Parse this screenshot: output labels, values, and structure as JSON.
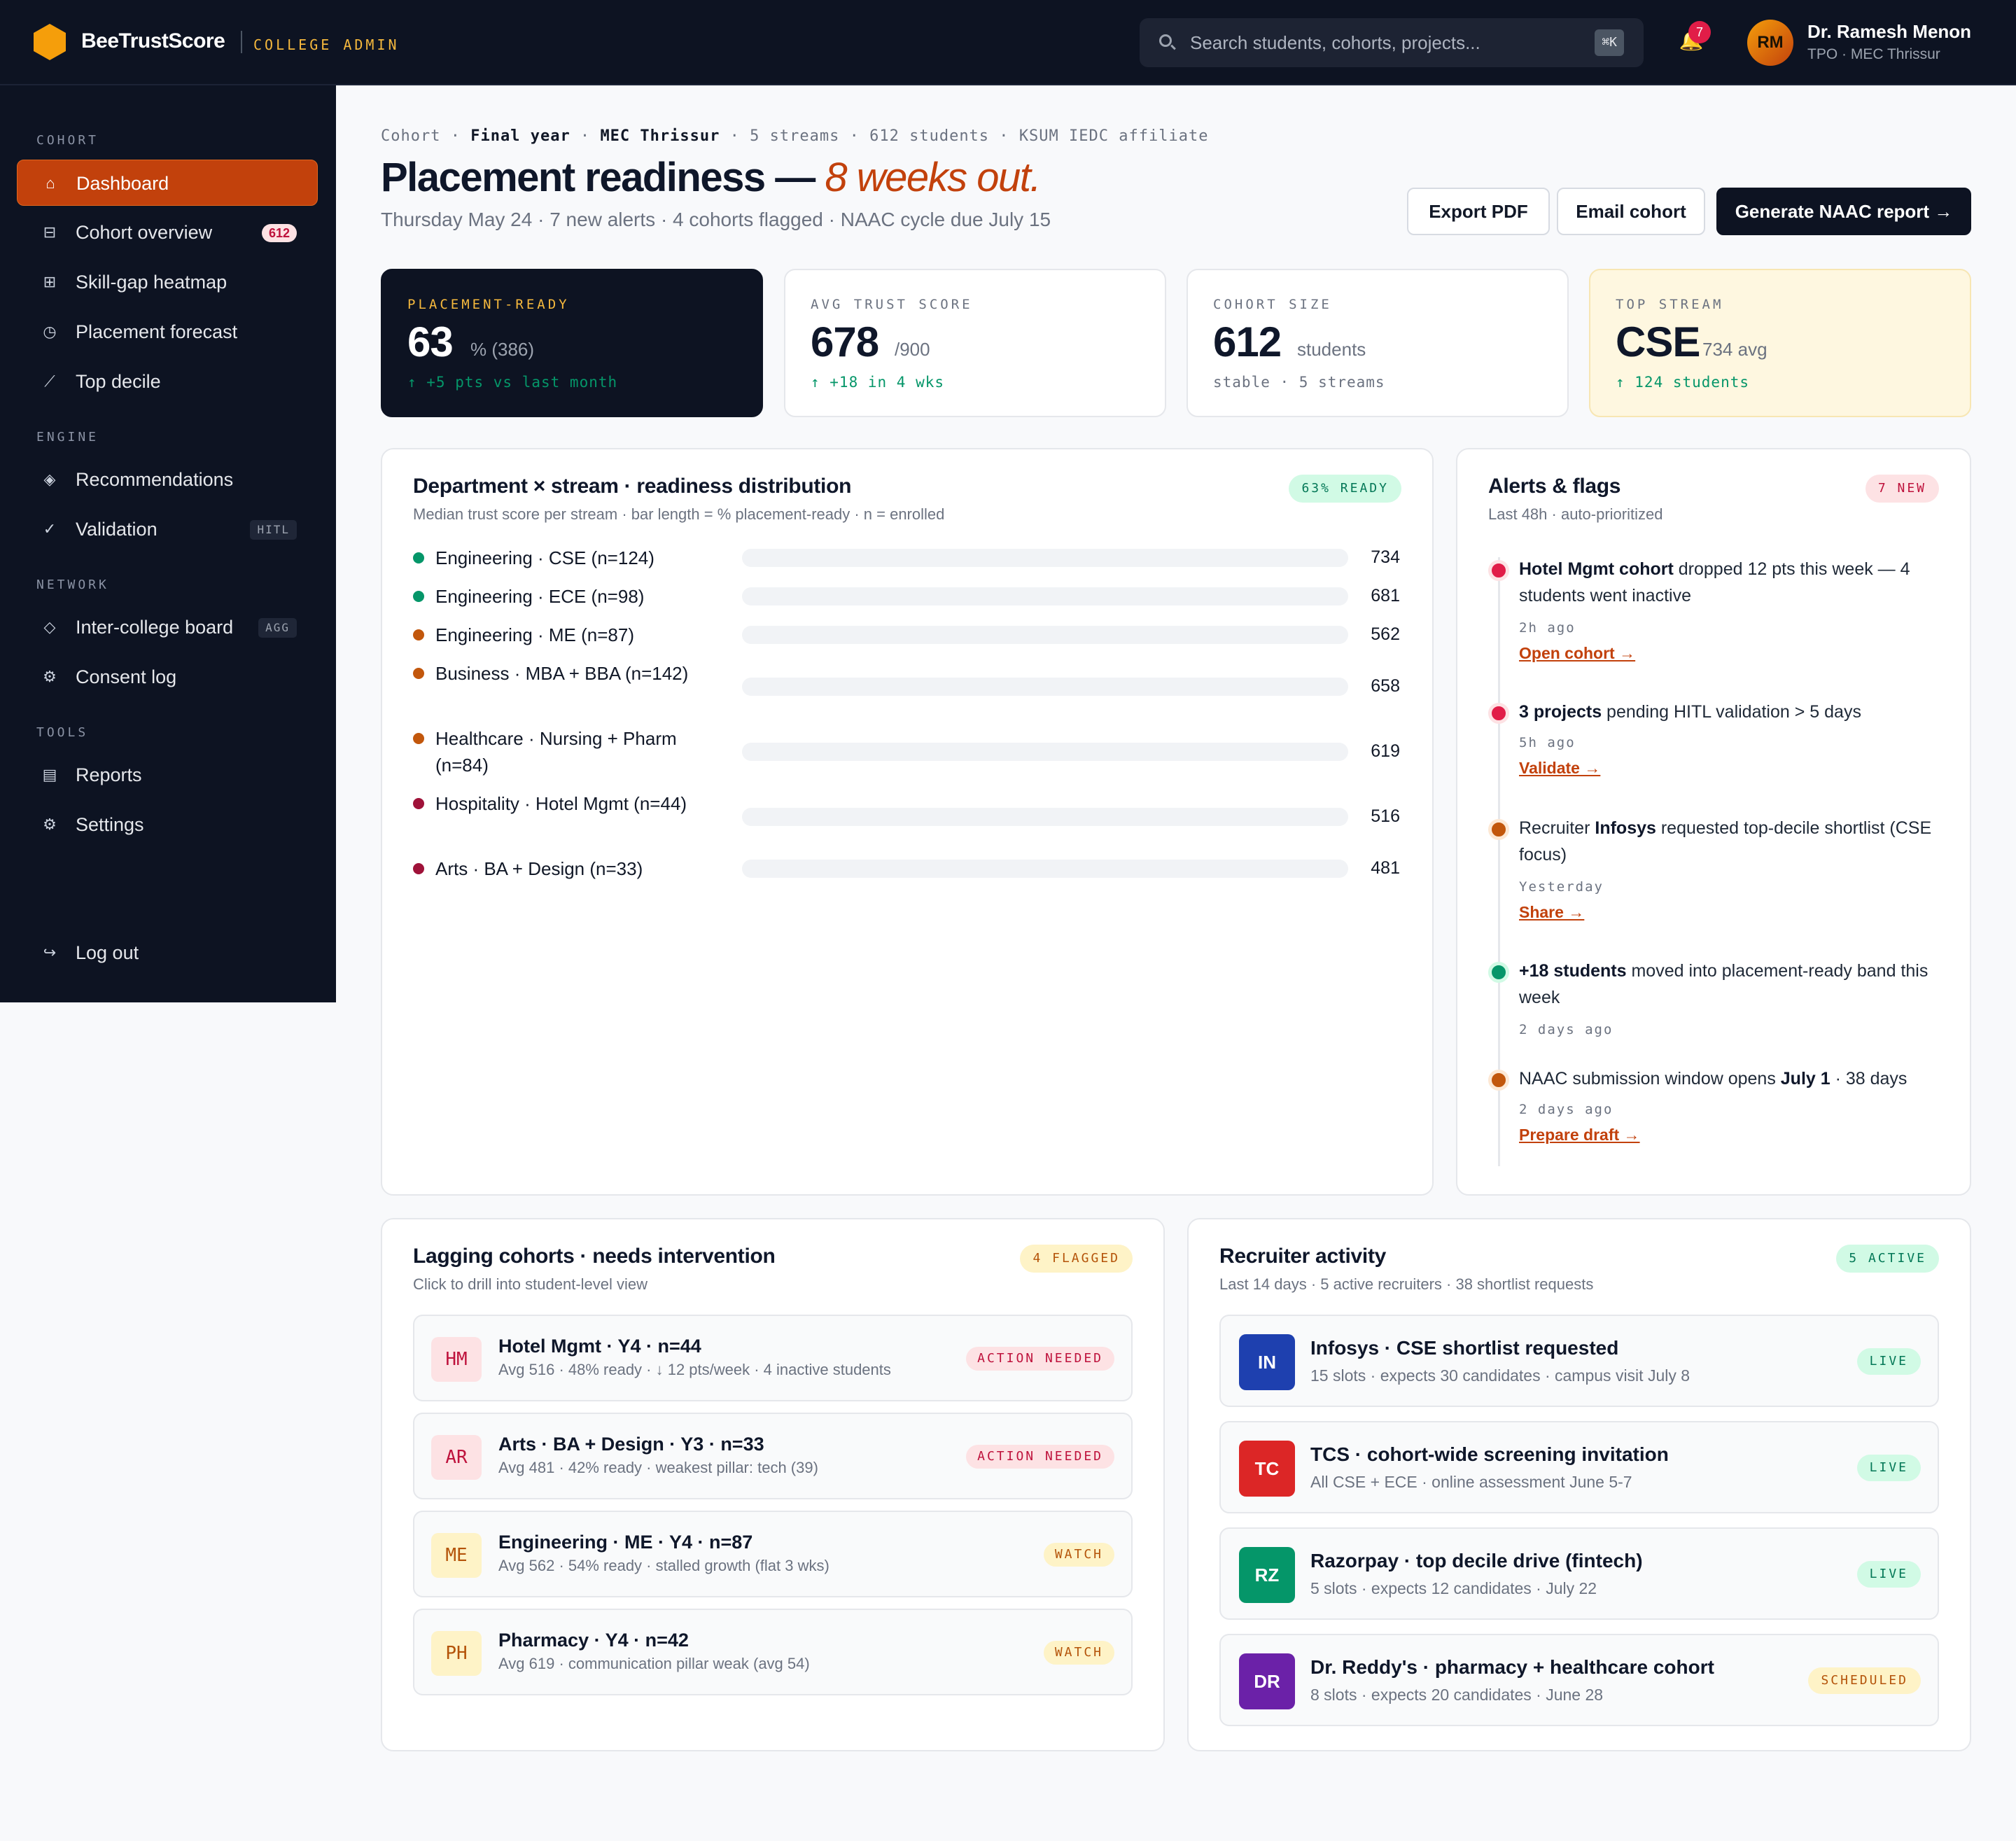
{
  "brand": {
    "name": "BeeTrustScore",
    "sub": "COLLEGE ADMIN"
  },
  "search": {
    "placeholder": "Search students, cohorts, projects...",
    "shortcut": "⌘K"
  },
  "notifications": {
    "count": "7"
  },
  "user": {
    "initials": "RM",
    "name": "Dr. Ramesh Menon",
    "role": "TPO · MEC Thrissur"
  },
  "sidebar": {
    "sections": [
      {
        "title": "COHORT",
        "items": [
          {
            "label": "Dashboard",
            "icon": "home-icon",
            "glyph": "⌂",
            "active": true
          },
          {
            "label": "Cohort overview",
            "icon": "list-icon",
            "glyph": "⊟",
            "badge": "612"
          },
          {
            "label": "Skill-gap heatmap",
            "icon": "grid-icon",
            "glyph": "⊞"
          },
          {
            "label": "Placement forecast",
            "icon": "clock-icon",
            "glyph": "◷"
          },
          {
            "label": "Top decile",
            "icon": "trend-icon",
            "glyph": "⟋"
          }
        ]
      },
      {
        "title": "ENGINE",
        "items": [
          {
            "label": "Recommendations",
            "icon": "diamond-icon",
            "glyph": "◈"
          },
          {
            "label": "Validation",
            "icon": "check-icon",
            "glyph": "✓",
            "tag": "HITL"
          }
        ]
      },
      {
        "title": "NETWORK",
        "items": [
          {
            "label": "Inter-college board",
            "icon": "diamond-outline-icon",
            "glyph": "◇",
            "tag": "AGG"
          },
          {
            "label": "Consent log",
            "icon": "gear-small-icon",
            "glyph": "⚙"
          }
        ]
      },
      {
        "title": "TOOLS",
        "items": [
          {
            "label": "Reports",
            "icon": "report-icon",
            "glyph": "▤"
          },
          {
            "label": "Settings",
            "icon": "gear-icon",
            "glyph": "⚙"
          }
        ]
      }
    ],
    "logout": {
      "label": "Log out",
      "icon": "logout-icon",
      "glyph": "↪"
    }
  },
  "header": {
    "crumbs": [
      "Cohort",
      "Final year",
      "MEC Thrissur",
      "5 streams",
      "612 students",
      "KSUM IEDC affiliate"
    ],
    "title_main": "Placement readiness —",
    "title_accent": "8 weeks out.",
    "subtitle": "Thursday May 24 · 7 new alerts · 4 cohorts flagged · NAAC cycle due July 15",
    "actions": {
      "export": "Export PDF",
      "email": "Email cohort",
      "generate": "Generate NAAC report →"
    }
  },
  "kpis": [
    {
      "label": "PLACEMENT-READY",
      "value": "63",
      "unit": "% (386)",
      "foot": "↑ +5 pts vs last month"
    },
    {
      "label": "AVG TRUST SCORE",
      "value": "678",
      "unit": "/900",
      "foot": "↑ +18 in 4 wks"
    },
    {
      "label": "COHORT SIZE",
      "value": "612",
      "unit": "students",
      "foot": "stable · 5 streams"
    },
    {
      "label": "TOP STREAM",
      "value": "CSE",
      "unit": "734 avg",
      "foot": "↑ 124 students"
    }
  ],
  "distribution": {
    "title": "Department × stream · readiness distribution",
    "subtitle": "Median trust score per stream · bar length = % placement-ready · n = enrolled",
    "badge": "63% READY",
    "colors": {
      "green": "#059669",
      "orange": "#c2570c",
      "crimson": "#9f1239"
    },
    "rows": [
      {
        "label": "Engineering · CSE (n=124)",
        "value": "734",
        "status": "green"
      },
      {
        "label": "Engineering · ECE (n=98)",
        "value": "681",
        "status": "green"
      },
      {
        "label": "Engineering · ME (n=87)",
        "value": "562",
        "status": "orange"
      },
      {
        "label": "Business · MBA + BBA (n=142)",
        "value": "658",
        "status": "orange"
      },
      {
        "label": "Healthcare · Nursing + Pharm (n=84)",
        "value": "619",
        "status": "orange"
      },
      {
        "label": "Hospitality · Hotel Mgmt (n=44)",
        "value": "516",
        "status": "crimson"
      },
      {
        "label": "Arts · BA + Design (n=33)",
        "value": "481",
        "status": "crimson"
      }
    ]
  },
  "alerts": {
    "title": "Alerts & flags",
    "subtitle": "Last 48h · auto-prioritized",
    "badge": "7 NEW",
    "items": [
      {
        "strong": "Hotel Mgmt cohort",
        "text": " dropped 12 pts this week — 4 students went inactive",
        "time": "2h ago",
        "link": "Open cohort →",
        "color": "#e11d48",
        "ring": "#fde2e4"
      },
      {
        "strong": "3 projects",
        "text": " pending HITL validation > 5 days",
        "time": "5h ago",
        "link": "Validate →",
        "color": "#e11d48",
        "ring": "#fde2e4"
      },
      {
        "pre": "Recruiter ",
        "strong": "Infosys",
        "text": " requested top-decile shortlist (CSE focus)",
        "time": "Yesterday",
        "link": "Share →",
        "color": "#c2570c",
        "ring": "#fde8d4"
      },
      {
        "strong": "+18 students",
        "text": " moved into placement-ready band this week",
        "time": "2 days ago",
        "link": "",
        "color": "#059669",
        "ring": "#d1fae5"
      },
      {
        "pre": "NAAC submission window opens ",
        "strong": "July 1",
        "text": " · 38 days",
        "time": "2 days ago",
        "link": "Prepare draft →",
        "color": "#c2570c",
        "ring": "#fde8d4"
      }
    ]
  },
  "lagging": {
    "title": "Lagging cohorts · needs intervention",
    "subtitle": "Click to drill into student-level view",
    "badge": "4 FLAGGED",
    "rows": [
      {
        "initials": "HM",
        "title": "Hotel Mgmt · Y4 · n=44",
        "sub": "Avg 516 · 48% ready · ↓ 12 pts/week · 4 inactive students",
        "status": "ACTION NEEDED",
        "tone": "red"
      },
      {
        "initials": "AR",
        "title": "Arts · BA + Design · Y3 · n=33",
        "sub": "Avg 481 · 42% ready · weakest pillar: tech (39)",
        "status": "ACTION NEEDED",
        "tone": "red"
      },
      {
        "initials": "ME",
        "title": "Engineering · ME · Y4 · n=87",
        "sub": "Avg 562 · 54% ready · stalled growth (flat 3 wks)",
        "status": "WATCH",
        "tone": "amber"
      },
      {
        "initials": "PH",
        "title": "Pharmacy · Y4 · n=42",
        "sub": "Avg 619 · communication pillar weak (avg 54)",
        "status": "WATCH",
        "tone": "amber"
      }
    ]
  },
  "recruiters": {
    "title": "Recruiter activity",
    "subtitle": "Last 14 days · 5 active recruiters · 38 shortlist requests",
    "badge": "5 ACTIVE",
    "rows": [
      {
        "initials": "IN",
        "title": "Infosys · CSE shortlist requested",
        "sub": "15 slots · expects 30 candidates · campus visit July 8",
        "status": "LIVE",
        "tone": "green",
        "color": "#1e40af"
      },
      {
        "initials": "TC",
        "title": "TCS · cohort-wide screening invitation",
        "sub": "All CSE + ECE · online assessment June 5-7",
        "status": "LIVE",
        "tone": "green",
        "color": "#dc2626"
      },
      {
        "initials": "RZ",
        "title": "Razorpay · top decile drive (fintech)",
        "sub": "5 slots · expects 12 candidates · July 22",
        "status": "LIVE",
        "tone": "green",
        "color": "#059669"
      },
      {
        "initials": "DR",
        "title": "Dr. Reddy's · pharmacy + healthcare cohort",
        "sub": "8 slots · expects 20 candidates · June 28",
        "status": "SCHEDULED",
        "tone": "amber",
        "color": "#6b21a8"
      }
    ]
  }
}
